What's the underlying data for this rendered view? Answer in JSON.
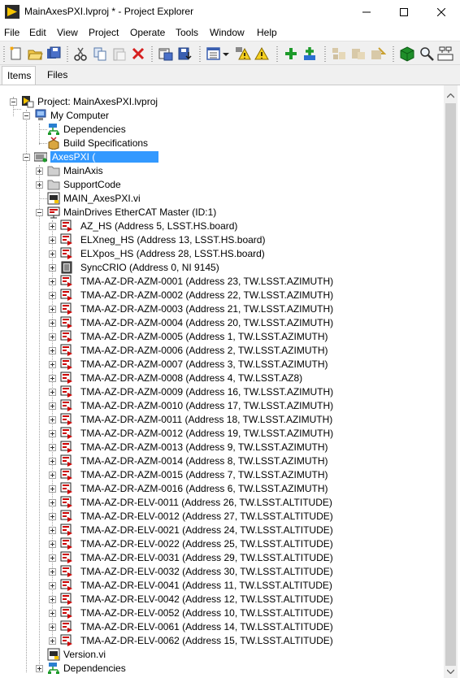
{
  "window": {
    "title": "MainAxesPXI.lvproj * - Project Explorer"
  },
  "menu": [
    "File",
    "Edit",
    "View",
    "Project",
    "Operate",
    "Tools",
    "Window",
    "Help"
  ],
  "toolbar_icons": [
    "new-icon",
    "open-icon",
    "save-all-icon",
    "cut-icon",
    "copy-icon",
    "paste-icon",
    "delete-icon",
    "build-icon",
    "deploy-icon",
    "view-icon",
    "dropdown-icon",
    "warning-icon",
    "add-icon",
    "add-folder-icon",
    "dependencies-icon",
    "filter-icon",
    "refresh-icon",
    "package-icon",
    "search-icon",
    "uml-icon"
  ],
  "tabs": [
    "Items",
    "Files"
  ],
  "active_tab": "Items",
  "tree": {
    "project": "Project: MainAxesPXI.lvproj",
    "my_computer": "My Computer",
    "mc_dependencies": "Dependencies",
    "mc_build": "Build Specifications",
    "target": "AxesPXI (",
    "main_axis": "MainAxis",
    "support_code": "SupportCode",
    "main_vi": "MAIN_AxesPXI.vi",
    "master": "MainDrives EtherCAT Master (ID:1)",
    "slaves": [
      "AZ_HS (Address 5, LSST.HS.board)",
      "ELXneg_HS (Address 13, LSST.HS.board)",
      "ELXpos_HS (Address 28, LSST.HS.board)",
      "SyncCRIO (Address 0, NI 9145)",
      "TMA-AZ-DR-AZM-0001 (Address 23, TW.LSST.AZIMUTH)",
      "TMA-AZ-DR-AZM-0002 (Address 22, TW.LSST.AZIMUTH)",
      "TMA-AZ-DR-AZM-0003 (Address 21, TW.LSST.AZIMUTH)",
      "TMA-AZ-DR-AZM-0004 (Address 20, TW.LSST.AZIMUTH)",
      "TMA-AZ-DR-AZM-0005 (Address 1, TW.LSST.AZIMUTH)",
      "TMA-AZ-DR-AZM-0006 (Address 2, TW.LSST.AZIMUTH)",
      "TMA-AZ-DR-AZM-0007 (Address 3, TW.LSST.AZIMUTH)",
      "TMA-AZ-DR-AZM-0008 (Address 4, TW.LSST.AZ8)",
      "TMA-AZ-DR-AZM-0009 (Address 16, TW.LSST.AZIMUTH)",
      "TMA-AZ-DR-AZM-0010 (Address 17, TW.LSST.AZIMUTH)",
      "TMA-AZ-DR-AZM-0011 (Address 18, TW.LSST.AZIMUTH)",
      "TMA-AZ-DR-AZM-0012 (Address 19, TW.LSST.AZIMUTH)",
      "TMA-AZ-DR-AZM-0013 (Address 9, TW.LSST.AZIMUTH)",
      "TMA-AZ-DR-AZM-0014 (Address 8, TW.LSST.AZIMUTH)",
      "TMA-AZ-DR-AZM-0015 (Address 7, TW.LSST.AZIMUTH)",
      "TMA-AZ-DR-AZM-0016 (Address 6, TW.LSST.AZIMUTH)",
      "TMA-AZ-DR-ELV-0011 (Address 26, TW.LSST.ALTITUDE)",
      "TMA-AZ-DR-ELV-0012 (Address 27, TW.LSST.ALTITUDE)",
      "TMA-AZ-DR-ELV-0021 (Address 24, TW.LSST.ALTITUDE)",
      "TMA-AZ-DR-ELV-0022 (Address 25, TW.LSST.ALTITUDE)",
      "TMA-AZ-DR-ELV-0031 (Address 29, TW.LSST.ALTITUDE)",
      "TMA-AZ-DR-ELV-0032 (Address 30, TW.LSST.ALTITUDE)",
      "TMA-AZ-DR-ELV-0041 (Address 11, TW.LSST.ALTITUDE)",
      "TMA-AZ-DR-ELV-0042 (Address 12, TW.LSST.ALTITUDE)",
      "TMA-AZ-DR-ELV-0052 (Address 10, TW.LSST.ALTITUDE)",
      "TMA-AZ-DR-ELV-0061 (Address 14, TW.LSST.ALTITUDE)",
      "TMA-AZ-DR-ELV-0062 (Address 15, TW.LSST.ALTITUDE)"
    ],
    "version_vi": "Version.vi",
    "target_dependencies": "Dependencies"
  },
  "colors": {
    "selection": "#3399ff",
    "drive_red": "#cc0000",
    "labview_yellow": "#f5c400"
  }
}
